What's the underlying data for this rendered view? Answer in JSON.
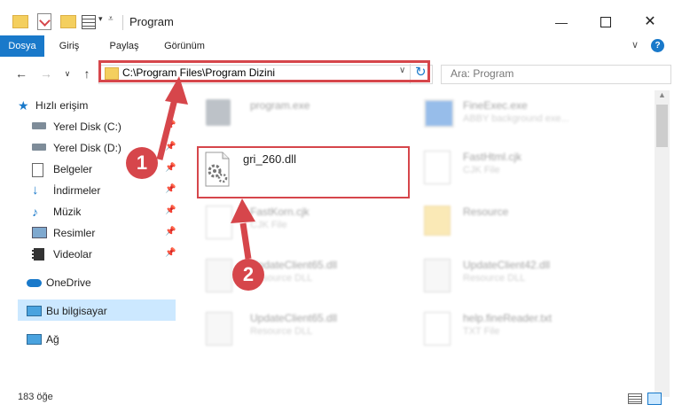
{
  "window": {
    "title": "Program"
  },
  "ribbon": {
    "tabs": [
      "Dosya",
      "Giriş",
      "Paylaş",
      "Görünüm"
    ]
  },
  "address": {
    "path": "C:\\Program Files\\Program Dizini"
  },
  "search": {
    "placeholder": "Ara: Program"
  },
  "sidebar": {
    "items": [
      {
        "label": "Hızlı erişim",
        "icon": "star-icon"
      },
      {
        "label": "Yerel Disk (C:)",
        "icon": "drive-icon"
      },
      {
        "label": "Yerel Disk (D:)",
        "icon": "drive-icon"
      },
      {
        "label": "Belgeler",
        "icon": "documents-icon"
      },
      {
        "label": "İndirmeler",
        "icon": "download-icon"
      },
      {
        "label": "Müzik",
        "icon": "music-icon"
      },
      {
        "label": "Resimler",
        "icon": "pictures-icon"
      },
      {
        "label": "Videolar",
        "icon": "videos-icon"
      },
      {
        "label": "OneDrive",
        "icon": "cloud-icon"
      },
      {
        "label": "Bu bilgisayar",
        "icon": "computer-icon"
      },
      {
        "label": "Ağ",
        "icon": "network-icon"
      }
    ]
  },
  "files": {
    "program_exe": {
      "name": "program.exe",
      "type": ""
    },
    "fineexec": {
      "name": "FineExec.exe",
      "type": "ABBY background exe..."
    },
    "highlighted": {
      "name": "gri_260.dll",
      "type": ""
    },
    "fasthtml": {
      "name": "FastHtml.cjk",
      "type": "CJK File"
    },
    "fastkorn": {
      "name": "FastKorn.cjk",
      "type": "CJK File"
    },
    "resource": {
      "name": "Resource",
      "type": ""
    },
    "update65a": {
      "name": "UpdateClient65.dll",
      "type": "Resource DLL"
    },
    "update42": {
      "name": "UpdateClient42.dll",
      "type": "Resource DLL"
    },
    "update65b": {
      "name": "UpdateClient65.dll",
      "type": "Resource DLL"
    },
    "helpfine": {
      "name": "help.fineReader.txt",
      "type": "TXT File"
    }
  },
  "annotations": {
    "step1": "1",
    "step2": "2"
  },
  "status": {
    "count": "183 öğe"
  },
  "colors": {
    "accent": "#1979ca",
    "highlight": "#d6464b",
    "selected": "#cce8ff"
  }
}
